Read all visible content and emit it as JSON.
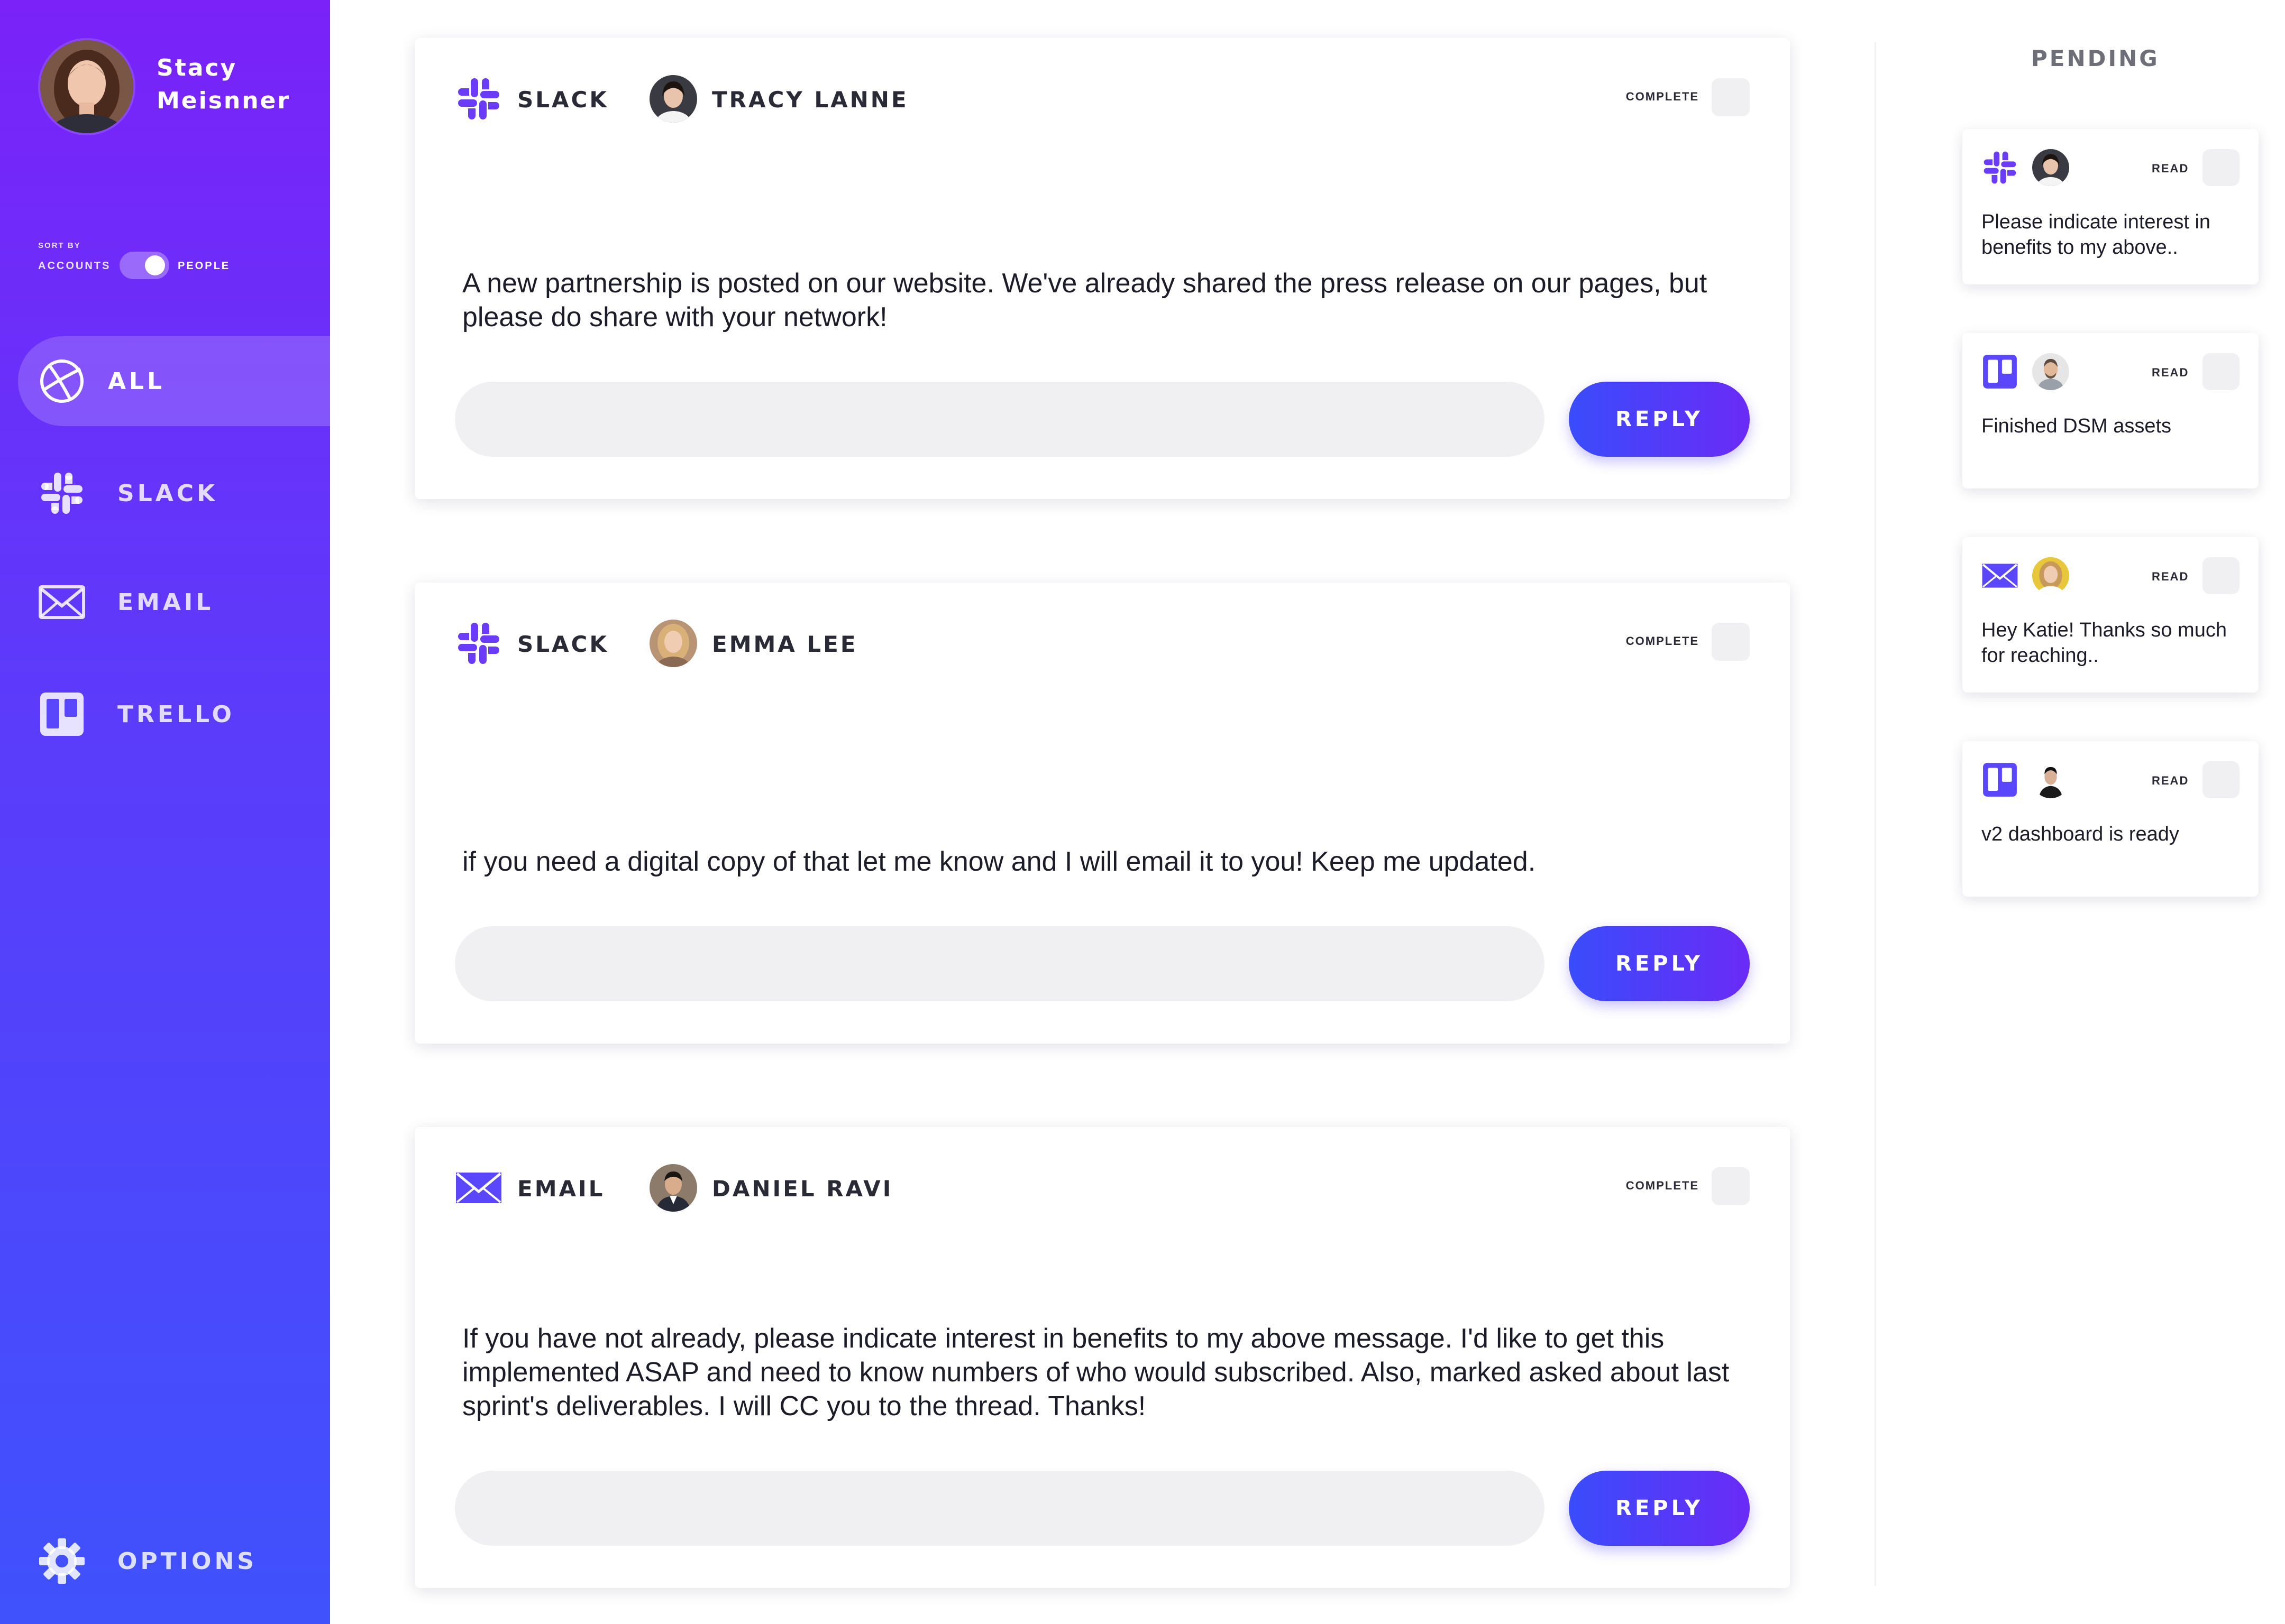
{
  "colors": {
    "sidebar_top": "#7a22f8",
    "sidebar_bottom": "#3f52fc",
    "accent_blue": "#3a4cfb",
    "accent_purple": "#6a2bf6",
    "input_bg": "#f0f0f2"
  },
  "profile": {
    "name": "Stacy Meisnner",
    "avatar_icon": "woman-avatar"
  },
  "sort": {
    "caption": "SORT BY",
    "left": "ACCOUNTS",
    "right": "PEOPLE",
    "selected": "PEOPLE"
  },
  "nav": {
    "items": [
      {
        "label": "ALL",
        "icon": "all-circle-icon",
        "active": true
      },
      {
        "label": "SLACK",
        "icon": "slack-icon",
        "active": false
      },
      {
        "label": "EMAIL",
        "icon": "envelope-icon",
        "active": false
      },
      {
        "label": "TRELLO",
        "icon": "trello-icon",
        "active": false
      }
    ],
    "options": {
      "label": "OPTIONS",
      "icon": "gear-icon"
    }
  },
  "messages": [
    {
      "source": "SLACK",
      "source_icon": "slack-icon",
      "person": "TRACY LANNE",
      "complete_label": "COMPLETE",
      "text": "A new partnership is posted on our website. We've already shared the press release on our pages, but please do share with your network!",
      "reply_label": "REPLY"
    },
    {
      "source": "SLACK",
      "source_icon": "slack-icon",
      "person": "EMMA LEE",
      "complete_label": "COMPLETE",
      "text": "if you need a digital copy of that let me know and I will email it to you! Keep me updated.",
      "reply_label": "REPLY"
    },
    {
      "source": "EMAIL",
      "source_icon": "envelope-icon",
      "person": "DANIEL RAVI",
      "complete_label": "COMPLETE",
      "text": "If you have not already, please indicate interest in benefits to my above message. I'd like to get this implemented ASAP and need to know numbers of who would subscribed. Also, marked asked about last sprint's deliverables. I will CC you to the thread. Thanks!",
      "reply_label": "REPLY"
    }
  ],
  "pending": {
    "title": "PENDING",
    "items": [
      {
        "source_icon": "slack-icon",
        "read_label": "READ",
        "text": "Please indicate interest in benefits to my above.."
      },
      {
        "source_icon": "trello-icon",
        "read_label": "READ",
        "text": "Finished DSM assets"
      },
      {
        "source_icon": "envelope-icon",
        "read_label": "READ",
        "text": "Hey Katie! Thanks so much for reaching.."
      },
      {
        "source_icon": "trello-icon",
        "read_label": "READ",
        "text": "v2 dashboard is ready"
      }
    ]
  }
}
